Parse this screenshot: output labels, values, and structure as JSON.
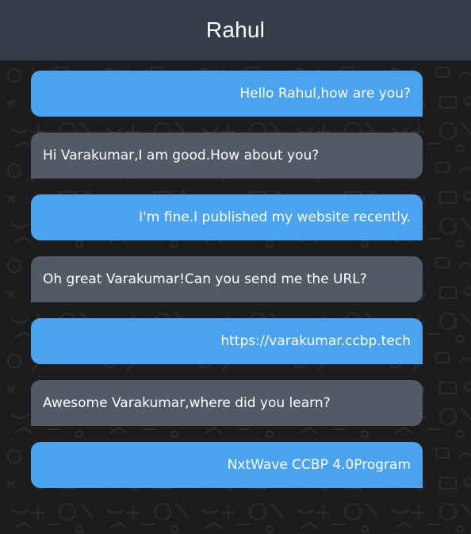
{
  "header": {
    "title": "Rahul"
  },
  "colors": {
    "header_bg": "#343e4a",
    "sent_bubble": "#4aa3ee",
    "received_bubble": "#515a65",
    "chat_background": "#1c1c1c",
    "text": "#ffffff"
  },
  "messages": [
    {
      "direction": "sent",
      "text": "Hello Rahul,how are you?"
    },
    {
      "direction": "received",
      "text": "Hi Varakumar,I am good.How about you?"
    },
    {
      "direction": "sent",
      "text": "I'm fine.I published my website recently."
    },
    {
      "direction": "received",
      "text": "Oh great Varakumar!Can you send me the URL?"
    },
    {
      "direction": "sent",
      "text": "https://varakumar.ccbp.tech"
    },
    {
      "direction": "received",
      "text": "Awesome Varakumar,where did you learn?"
    },
    {
      "direction": "sent",
      "text": "NxtWave CCBP 4.0Program"
    }
  ]
}
